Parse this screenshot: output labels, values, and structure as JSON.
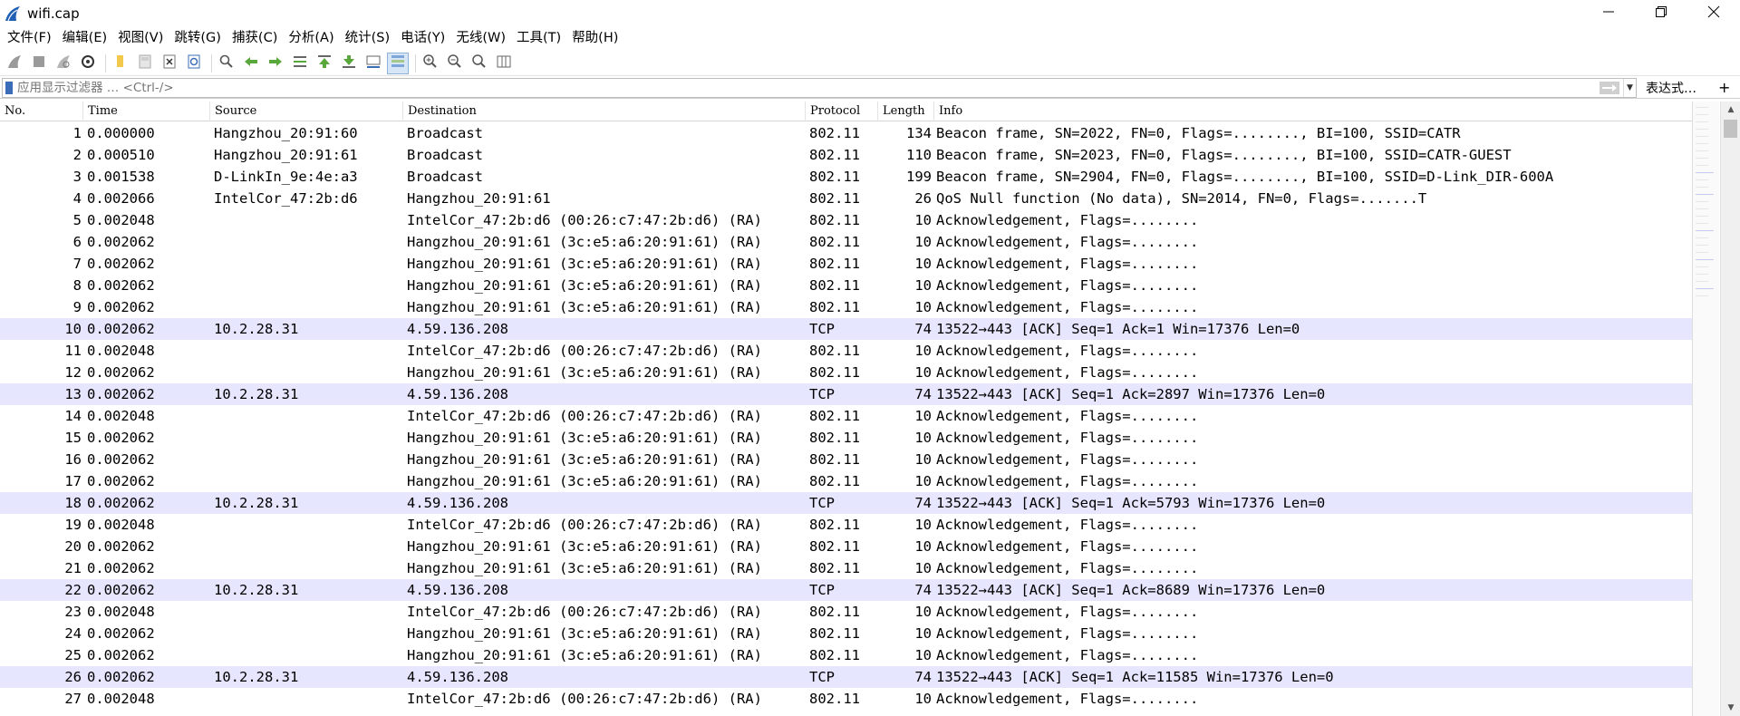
{
  "window": {
    "title": "wifi.cap"
  },
  "menu": [
    "文件(F)",
    "编辑(E)",
    "视图(V)",
    "跳转(G)",
    "捕获(C)",
    "分析(A)",
    "统计(S)",
    "电话(Y)",
    "无线(W)",
    "工具(T)",
    "帮助(H)"
  ],
  "toolbar_icons": [
    "shark-fin-start-icon",
    "stop-square-icon",
    "restart-fin-icon",
    "capture-options-gear-icon",
    "open-folder-icon",
    "save-file-icon",
    "close-file-icon",
    "reload-file-icon",
    "find-magnifier-icon",
    "go-back-arrow-icon",
    "go-forward-arrow-icon",
    "go-to-packet-icon",
    "first-packet-icon",
    "last-packet-icon",
    "autoscroll-icon",
    "colorize-list-icon",
    "zoom-in-icon",
    "zoom-out-icon",
    "normal-size-icon",
    "resize-columns-icon"
  ],
  "filter": {
    "placeholder": "应用显示过滤器 … <Ctrl-/>",
    "expression_label": "表达式…",
    "add_label": "+"
  },
  "columns": {
    "no": "No.",
    "time": "Time",
    "source": "Source",
    "destination": "Destination",
    "protocol": "Protocol",
    "length": "Length",
    "info": "Info"
  },
  "colors": {
    "tcp_row_bg": "#e7e6ff"
  },
  "packets": [
    {
      "no": "1",
      "time": "0.000000",
      "src": "Hangzhou_20:91:60",
      "dst": "Broadcast",
      "proto": "802.11",
      "len": "134",
      "info": "Beacon frame, SN=2022, FN=0, Flags=........, BI=100, SSID=CATR",
      "tcp": false
    },
    {
      "no": "2",
      "time": "0.000510",
      "src": "Hangzhou_20:91:61",
      "dst": "Broadcast",
      "proto": "802.11",
      "len": "110",
      "info": "Beacon frame, SN=2023, FN=0, Flags=........, BI=100, SSID=CATR-GUEST",
      "tcp": false
    },
    {
      "no": "3",
      "time": "0.001538",
      "src": "D-LinkIn_9e:4e:a3",
      "dst": "Broadcast",
      "proto": "802.11",
      "len": "199",
      "info": "Beacon frame, SN=2904, FN=0, Flags=........, BI=100, SSID=D-Link_DIR-600A",
      "tcp": false
    },
    {
      "no": "4",
      "time": "0.002066",
      "src": "IntelCor_47:2b:d6",
      "dst": "Hangzhou_20:91:61",
      "proto": "802.11",
      "len": "26",
      "info": "QoS Null function (No data), SN=2014, FN=0, Flags=.......T",
      "tcp": false
    },
    {
      "no": "5",
      "time": "0.002048",
      "src": "",
      "dst": "IntelCor_47:2b:d6 (00:26:c7:47:2b:d6) (RA)",
      "proto": "802.11",
      "len": "10",
      "info": "Acknowledgement, Flags=........",
      "tcp": false
    },
    {
      "no": "6",
      "time": "0.002062",
      "src": "",
      "dst": "Hangzhou_20:91:61 (3c:e5:a6:20:91:61) (RA)",
      "proto": "802.11",
      "len": "10",
      "info": "Acknowledgement, Flags=........",
      "tcp": false
    },
    {
      "no": "7",
      "time": "0.002062",
      "src": "",
      "dst": "Hangzhou_20:91:61 (3c:e5:a6:20:91:61) (RA)",
      "proto": "802.11",
      "len": "10",
      "info": "Acknowledgement, Flags=........",
      "tcp": false
    },
    {
      "no": "8",
      "time": "0.002062",
      "src": "",
      "dst": "Hangzhou_20:91:61 (3c:e5:a6:20:91:61) (RA)",
      "proto": "802.11",
      "len": "10",
      "info": "Acknowledgement, Flags=........",
      "tcp": false
    },
    {
      "no": "9",
      "time": "0.002062",
      "src": "",
      "dst": "Hangzhou_20:91:61 (3c:e5:a6:20:91:61) (RA)",
      "proto": "802.11",
      "len": "10",
      "info": "Acknowledgement, Flags=........",
      "tcp": false
    },
    {
      "no": "10",
      "time": "0.002062",
      "src": "10.2.28.31",
      "dst": "4.59.136.208",
      "proto": "TCP",
      "len": "74",
      "info": "13522→443 [ACK] Seq=1 Ack=1 Win=17376 Len=0",
      "tcp": true
    },
    {
      "no": "11",
      "time": "0.002048",
      "src": "",
      "dst": "IntelCor_47:2b:d6 (00:26:c7:47:2b:d6) (RA)",
      "proto": "802.11",
      "len": "10",
      "info": "Acknowledgement, Flags=........",
      "tcp": false
    },
    {
      "no": "12",
      "time": "0.002062",
      "src": "",
      "dst": "Hangzhou_20:91:61 (3c:e5:a6:20:91:61) (RA)",
      "proto": "802.11",
      "len": "10",
      "info": "Acknowledgement, Flags=........",
      "tcp": false
    },
    {
      "no": "13",
      "time": "0.002062",
      "src": "10.2.28.31",
      "dst": "4.59.136.208",
      "proto": "TCP",
      "len": "74",
      "info": "13522→443 [ACK] Seq=1 Ack=2897 Win=17376 Len=0",
      "tcp": true
    },
    {
      "no": "14",
      "time": "0.002048",
      "src": "",
      "dst": "IntelCor_47:2b:d6 (00:26:c7:47:2b:d6) (RA)",
      "proto": "802.11",
      "len": "10",
      "info": "Acknowledgement, Flags=........",
      "tcp": false
    },
    {
      "no": "15",
      "time": "0.002062",
      "src": "",
      "dst": "Hangzhou_20:91:61 (3c:e5:a6:20:91:61) (RA)",
      "proto": "802.11",
      "len": "10",
      "info": "Acknowledgement, Flags=........",
      "tcp": false
    },
    {
      "no": "16",
      "time": "0.002062",
      "src": "",
      "dst": "Hangzhou_20:91:61 (3c:e5:a6:20:91:61) (RA)",
      "proto": "802.11",
      "len": "10",
      "info": "Acknowledgement, Flags=........",
      "tcp": false
    },
    {
      "no": "17",
      "time": "0.002062",
      "src": "",
      "dst": "Hangzhou_20:91:61 (3c:e5:a6:20:91:61) (RA)",
      "proto": "802.11",
      "len": "10",
      "info": "Acknowledgement, Flags=........",
      "tcp": false
    },
    {
      "no": "18",
      "time": "0.002062",
      "src": "10.2.28.31",
      "dst": "4.59.136.208",
      "proto": "TCP",
      "len": "74",
      "info": "13522→443 [ACK] Seq=1 Ack=5793 Win=17376 Len=0",
      "tcp": true
    },
    {
      "no": "19",
      "time": "0.002048",
      "src": "",
      "dst": "IntelCor_47:2b:d6 (00:26:c7:47:2b:d6) (RA)",
      "proto": "802.11",
      "len": "10",
      "info": "Acknowledgement, Flags=........",
      "tcp": false
    },
    {
      "no": "20",
      "time": "0.002062",
      "src": "",
      "dst": "Hangzhou_20:91:61 (3c:e5:a6:20:91:61) (RA)",
      "proto": "802.11",
      "len": "10",
      "info": "Acknowledgement, Flags=........",
      "tcp": false
    },
    {
      "no": "21",
      "time": "0.002062",
      "src": "",
      "dst": "Hangzhou_20:91:61 (3c:e5:a6:20:91:61) (RA)",
      "proto": "802.11",
      "len": "10",
      "info": "Acknowledgement, Flags=........",
      "tcp": false
    },
    {
      "no": "22",
      "time": "0.002062",
      "src": "10.2.28.31",
      "dst": "4.59.136.208",
      "proto": "TCP",
      "len": "74",
      "info": "13522→443 [ACK] Seq=1 Ack=8689 Win=17376 Len=0",
      "tcp": true
    },
    {
      "no": "23",
      "time": "0.002048",
      "src": "",
      "dst": "IntelCor_47:2b:d6 (00:26:c7:47:2b:d6) (RA)",
      "proto": "802.11",
      "len": "10",
      "info": "Acknowledgement, Flags=........",
      "tcp": false
    },
    {
      "no": "24",
      "time": "0.002062",
      "src": "",
      "dst": "Hangzhou_20:91:61 (3c:e5:a6:20:91:61) (RA)",
      "proto": "802.11",
      "len": "10",
      "info": "Acknowledgement, Flags=........",
      "tcp": false
    },
    {
      "no": "25",
      "time": "0.002062",
      "src": "",
      "dst": "Hangzhou_20:91:61 (3c:e5:a6:20:91:61) (RA)",
      "proto": "802.11",
      "len": "10",
      "info": "Acknowledgement, Flags=........",
      "tcp": false
    },
    {
      "no": "26",
      "time": "0.002062",
      "src": "10.2.28.31",
      "dst": "4.59.136.208",
      "proto": "TCP",
      "len": "74",
      "info": "13522→443 [ACK] Seq=1 Ack=11585 Win=17376 Len=0",
      "tcp": true
    },
    {
      "no": "27",
      "time": "0.002048",
      "src": "",
      "dst": "IntelCor_47:2b:d6 (00:26:c7:47:2b:d6) (RA)",
      "proto": "802.11",
      "len": "10",
      "info": "Acknowledgement, Flags=........",
      "tcp": false
    }
  ]
}
